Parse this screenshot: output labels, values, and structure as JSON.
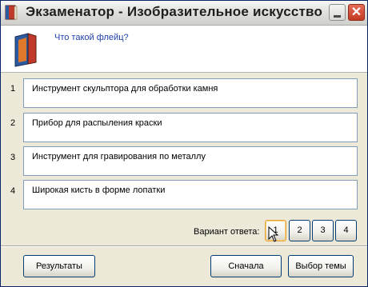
{
  "window": {
    "title": "Экзаменатор - Изобразительное искусство"
  },
  "question": {
    "text": "Что такой флейц?"
  },
  "answers": [
    {
      "number": "1",
      "text": "Инструмент скульптора для обработки камня"
    },
    {
      "number": "2",
      "text": "Прибор для распыления краски"
    },
    {
      "number": "3",
      "text": "Инструмент для гравирования по металлу"
    },
    {
      "number": "4",
      "text": "Широкая кисть в форме лопатки"
    }
  ],
  "variant": {
    "label": "Вариант ответа:",
    "options": [
      "1",
      "2",
      "3",
      "4"
    ]
  },
  "footer": {
    "results_label": "Результаты",
    "restart_label": "Сначала",
    "topics_label": "Выбор темы"
  },
  "titlebar": {
    "close_glyph": "✕"
  }
}
